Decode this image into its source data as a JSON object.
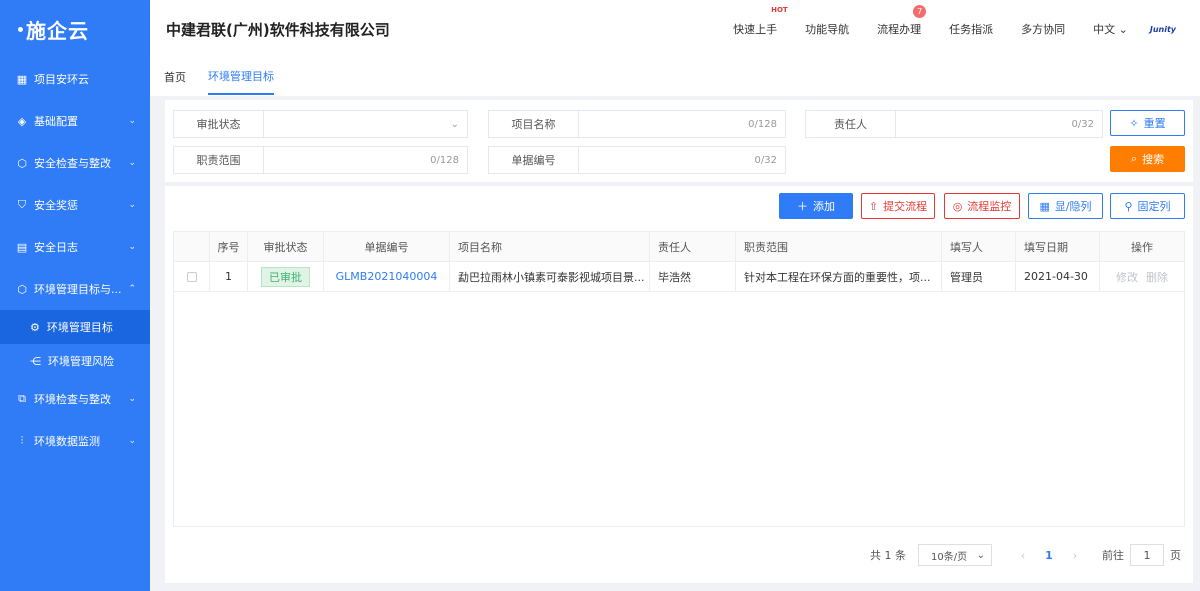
{
  "sidebar": {
    "logo": "施企云",
    "items": [
      {
        "label": "项目安环云",
        "icon": "grid-icon",
        "expandable": false
      },
      {
        "label": "基础配置",
        "icon": "layers-icon",
        "expandable": true
      },
      {
        "label": "安全检查与整改",
        "icon": "box-icon",
        "expandable": true
      },
      {
        "label": "安全奖惩",
        "icon": "shield-icon",
        "expandable": true
      },
      {
        "label": "安全日志",
        "icon": "film-icon",
        "expandable": true
      },
      {
        "label": "环境管理目标与...",
        "icon": "cube-icon",
        "expandable": true,
        "expanded": true
      }
    ],
    "sub_items": [
      {
        "label": "环境管理目标",
        "icon": "settings-icon",
        "active": true
      },
      {
        "label": "环境管理风险",
        "icon": "branch-icon",
        "active": false
      }
    ],
    "items_after": [
      {
        "label": "环境检查与整改",
        "icon": "device-icon",
        "expandable": true
      },
      {
        "label": "环境数据监测",
        "icon": "sliders-icon",
        "expandable": true
      }
    ]
  },
  "header": {
    "company": "中建君联(广州)软件科技有限公司",
    "nav": [
      "快速上手",
      "功能导航",
      "流程办理",
      "任务指派",
      "多方协同"
    ],
    "hot_label": "HOT",
    "badge_count": "7",
    "language": "中文",
    "brand": "Junity"
  },
  "tabs": [
    "首页",
    "环境管理目标"
  ],
  "filters": {
    "status_label": "审批状态",
    "project_label": "项目名称",
    "project_counter": "0/128",
    "owner_label": "责任人",
    "owner_counter": "0/32",
    "scope_label": "职责范围",
    "scope_counter": "0/128",
    "number_label": "单据编号",
    "number_counter": "0/32",
    "reset": "重置",
    "search": "搜索"
  },
  "toolbar": {
    "add": "添加",
    "submit_flow": "提交流程",
    "monitor_flow": "流程监控",
    "show_hide": "显/隐列",
    "pin_col": "固定列"
  },
  "table": {
    "headers": [
      "序号",
      "审批状态",
      "单据编号",
      "项目名称",
      "责任人",
      "职责范围",
      "填写人",
      "填写日期",
      "操作"
    ],
    "rows": [
      {
        "index": "1",
        "status": "已审批",
        "number": "GLMB2021040004",
        "project": "勐巴拉雨林小镇素可泰影视城项目景...",
        "owner": "毕浩然",
        "scope": "针对本工程在环保方面的重要性，项...",
        "writer": "管理员",
        "date": "2021-04-30",
        "edit": "修改",
        "delete": "删除"
      }
    ]
  },
  "pager": {
    "total": "共 1 条",
    "page_size": "10条/页",
    "current": "1",
    "goto_label": "前往",
    "goto_value": "1",
    "page_unit": "页"
  },
  "colors": {
    "sidebar": "#2f7cf6",
    "accent": "#2f7cf6",
    "search": "#ff7d00",
    "danger": "#e53935"
  }
}
